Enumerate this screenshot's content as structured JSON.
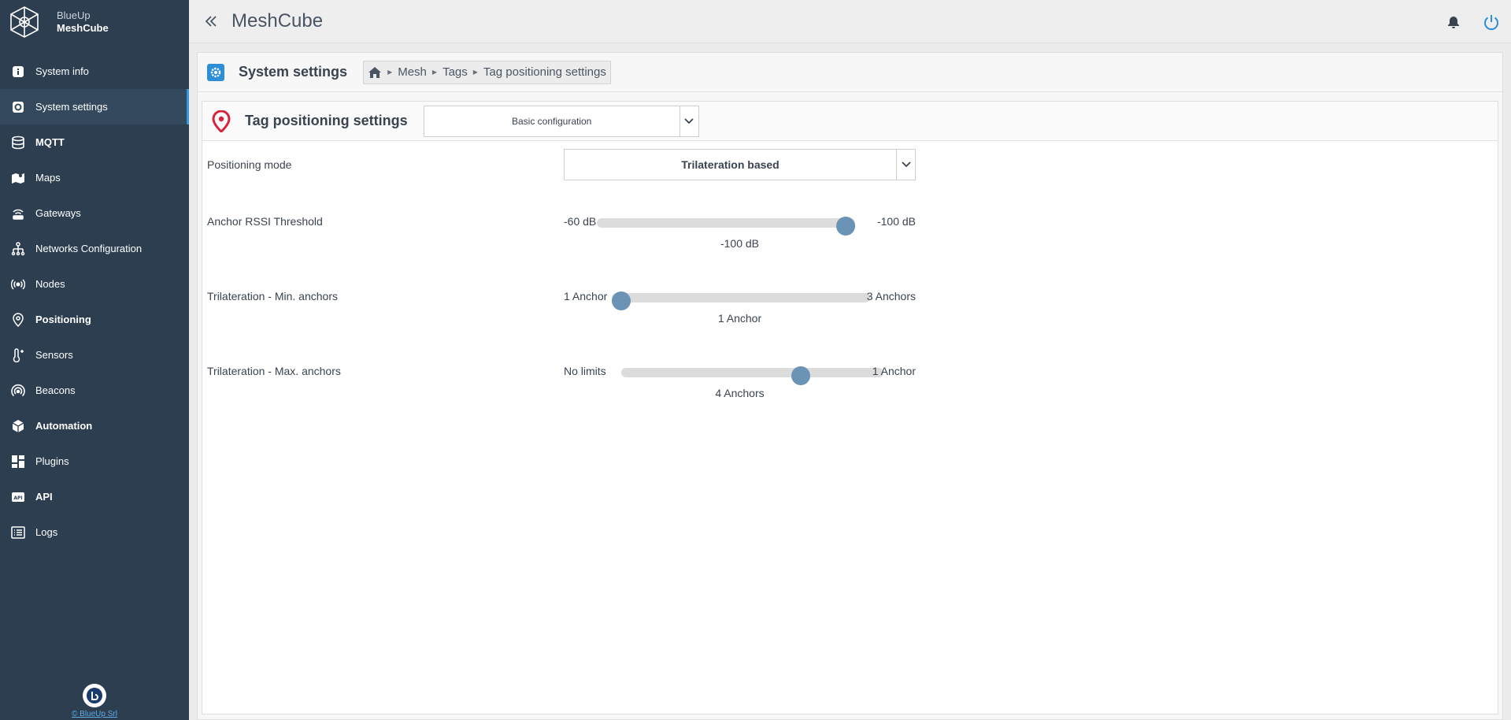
{
  "brand": {
    "line1": "BlueUp",
    "line2": "MeshCube"
  },
  "sidebar": {
    "items": [
      {
        "label": "System info",
        "icon": "info-icon"
      },
      {
        "label": "System settings",
        "icon": "settings-icon"
      },
      {
        "label": "MQTT",
        "icon": "database-icon"
      },
      {
        "label": "Maps",
        "icon": "map-icon"
      },
      {
        "label": "Gateways",
        "icon": "router-icon"
      },
      {
        "label": "Networks Configuration",
        "icon": "network-icon"
      },
      {
        "label": "Nodes",
        "icon": "broadcast-icon"
      },
      {
        "label": "Positioning",
        "icon": "location-pin-icon"
      },
      {
        "label": "Sensors",
        "icon": "thermometer-icon"
      },
      {
        "label": "Beacons",
        "icon": "beacon-icon"
      },
      {
        "label": "Automation",
        "icon": "cube-icon"
      },
      {
        "label": "Plugins",
        "icon": "dashboard-icon"
      },
      {
        "label": "API",
        "icon": "api-icon"
      },
      {
        "label": "Logs",
        "icon": "list-icon"
      }
    ],
    "active_index": 1,
    "footer_text": "© BlueUp Srl"
  },
  "topbar": {
    "title": "MeshCube"
  },
  "header": {
    "title": "System settings",
    "breadcrumb": [
      "Mesh",
      "Tags",
      "Tag positioning settings"
    ]
  },
  "card": {
    "title": "Tag positioning settings",
    "config_select": "Basic configuration"
  },
  "settings": {
    "positioning_mode": {
      "label": "Positioning mode",
      "value": "Trilateration based"
    },
    "rssi": {
      "label": "Anchor RSSI Threshold",
      "min_label": "-60 dB",
      "max_label": "-100 dB",
      "value": "-100 dB",
      "fraction": 1.0
    },
    "min_anchors": {
      "label": "Trilateration - Min. anchors",
      "min_label": "1 Anchor",
      "max_label": "3 Anchors",
      "value": "1 Anchor",
      "fraction": 0.0
    },
    "max_anchors": {
      "label": "Trilateration - Max. anchors",
      "min_label": "No limits",
      "max_label": "1 Anchor",
      "value": "4 Anchors",
      "fraction": 0.7
    }
  },
  "colors": {
    "sidebar_bg": "#2c3e50",
    "accent": "#3498db",
    "slider_thumb": "#6b93b5",
    "pin": "#d9223c"
  }
}
